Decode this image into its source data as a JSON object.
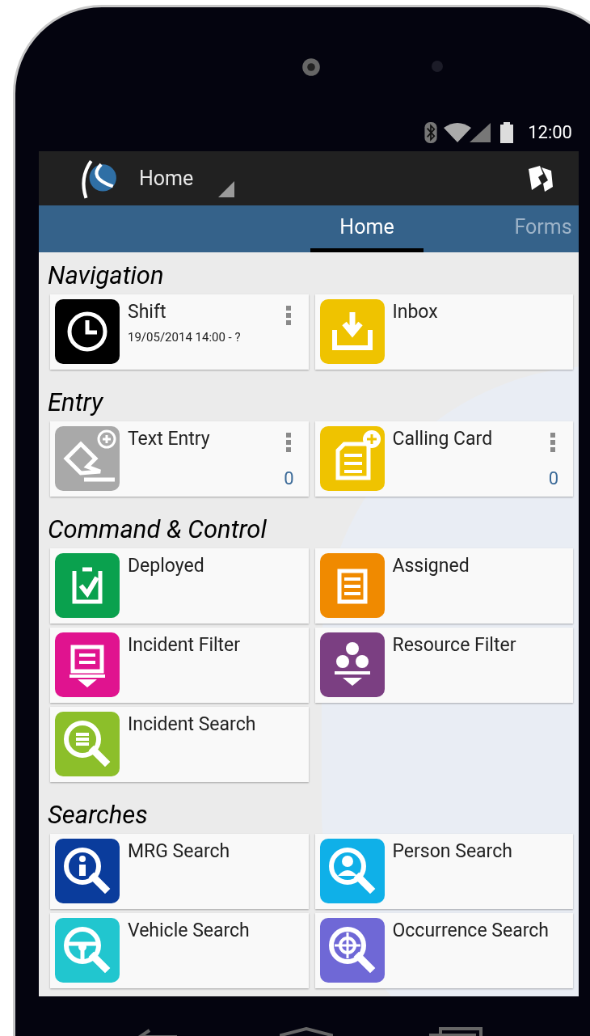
{
  "status_bar": {
    "time": "12:00"
  },
  "app_bar": {
    "title": "Home"
  },
  "tabs": [
    {
      "label": "Home",
      "selected": true
    },
    {
      "label": "Forms",
      "selected": false
    }
  ],
  "sections": [
    {
      "title": "Navigation",
      "tiles": [
        {
          "kind": "clock",
          "color": "#000000",
          "title": "Shift",
          "subtitle": "19/05/2014 14:00 - ?",
          "menu": true
        },
        {
          "kind": "download",
          "color": "#efc300",
          "title": "Inbox",
          "menu": false
        }
      ]
    },
    {
      "title": "Entry",
      "tiles": [
        {
          "kind": "pencil",
          "color": "#a9a9a9",
          "title": "Text Entry",
          "menu": true,
          "count": "0"
        },
        {
          "kind": "card",
          "color": "#efc300",
          "title": "Calling Card",
          "menu": true,
          "count": "0"
        }
      ]
    },
    {
      "title": "Command & Control",
      "tiles": [
        {
          "kind": "check",
          "color": "#0aa14e",
          "title": "Deployed",
          "menu": false
        },
        {
          "kind": "list",
          "color": "#f08a00",
          "title": "Assigned",
          "menu": false
        },
        {
          "kind": "filter",
          "color": "#e0138f",
          "title": "Incident Filter",
          "menu": false
        },
        {
          "kind": "dots",
          "color": "#7b3f82",
          "title": "Resource Filter",
          "menu": false
        },
        {
          "kind": "search-list",
          "color": "#8cbf2a",
          "title": "Incident Search",
          "menu": false
        }
      ]
    },
    {
      "title": "Searches",
      "tiles": [
        {
          "kind": "search-info",
          "color": "#0a3c9c",
          "title": "MRG Search",
          "menu": false
        },
        {
          "kind": "search-person",
          "color": "#0fb0e8",
          "title": "Person Search",
          "menu": false
        },
        {
          "kind": "search-wheel",
          "color": "#21c6cf",
          "title": "Vehicle Search",
          "menu": false
        },
        {
          "kind": "search-target",
          "color": "#6f68d6",
          "title": "Occurrence Search",
          "menu": false
        }
      ]
    }
  ]
}
